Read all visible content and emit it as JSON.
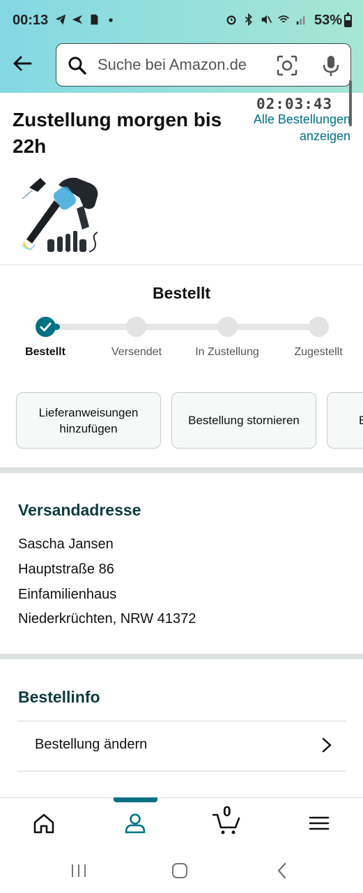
{
  "status_bar": {
    "time": "00:13",
    "battery": "53%",
    "left_icons": [
      "telegram-icon",
      "send-icon",
      "sim-icon",
      "dot-icon"
    ],
    "right_icons": [
      "alarm-icon",
      "bluetooth-icon",
      "mute-icon",
      "wifi-call-icon",
      "signal-icon"
    ]
  },
  "search": {
    "placeholder": "Suche bei Amazon.de"
  },
  "delivery": {
    "title": "Zustellung morgen bis 22h",
    "countdown": "02:03:43",
    "all_orders_link": "Alle Bestellungen anzeigen"
  },
  "tracker": {
    "title": "Bestellt",
    "progress": 0,
    "steps": [
      {
        "label": "Bestellt",
        "done": true
      },
      {
        "label": "Versendet",
        "done": false
      },
      {
        "label": "In Zustellung",
        "done": false
      },
      {
        "label": "Zugestellt",
        "done": false
      }
    ]
  },
  "actions": {
    "add_instructions": "Lieferanweisungen hinzufügen",
    "cancel_order": "Bestellung stornieren",
    "third_partial": "B"
  },
  "shipping_address": {
    "title": "Versandadresse",
    "name": "Sascha Jansen",
    "street": "Hauptstraße 86",
    "extra": "Einfamilienhaus",
    "city": "Niederkrüchten, NRW 41372"
  },
  "order_info": {
    "title": "Bestellinfo",
    "change_order": "Bestellung ändern"
  },
  "bottom_nav": {
    "cart_count": "0",
    "active": "account"
  },
  "colors": {
    "accent": "#007185",
    "header_start": "#84d8e3",
    "header_end": "#a6e6d4"
  }
}
